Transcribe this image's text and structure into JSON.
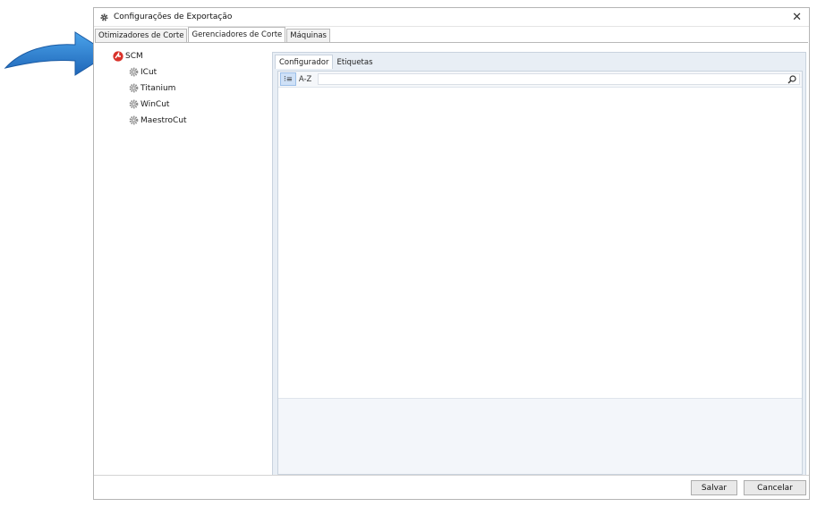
{
  "window": {
    "title": "Configurações de Exportação",
    "close_glyph": "✕"
  },
  "tabs": [
    {
      "label": "Otimizadores de Corte",
      "active": false
    },
    {
      "label": "Gerenciadores de Corte",
      "active": true
    },
    {
      "label": "Máquinas",
      "active": false
    }
  ],
  "tree": {
    "root": {
      "label": "SCM",
      "icon": "scm-logo-icon"
    },
    "children": [
      {
        "label": "ICut",
        "icon": "gear-icon"
      },
      {
        "label": "Titanium",
        "icon": "gear-icon"
      },
      {
        "label": "WinCut",
        "icon": "gear-icon"
      },
      {
        "label": "MaestroCut",
        "icon": "gear-icon"
      }
    ]
  },
  "panel": {
    "subtabs": [
      {
        "label": "Configurador",
        "active": true
      },
      {
        "label": "Etiquetas",
        "active": false
      }
    ],
    "toolbar": {
      "categorized_glyph": "⁝≡",
      "az_label": "A-Z",
      "search_value": "",
      "search_placeholder": ""
    }
  },
  "footer": {
    "save_label": "Salvar",
    "cancel_label": "Cancelar"
  },
  "colors": {
    "arrow": "#2f7fd0",
    "scm_logo": "#d9322a",
    "selected_tab": "#cfe1f7",
    "panel_bg": "#e8eef5"
  }
}
